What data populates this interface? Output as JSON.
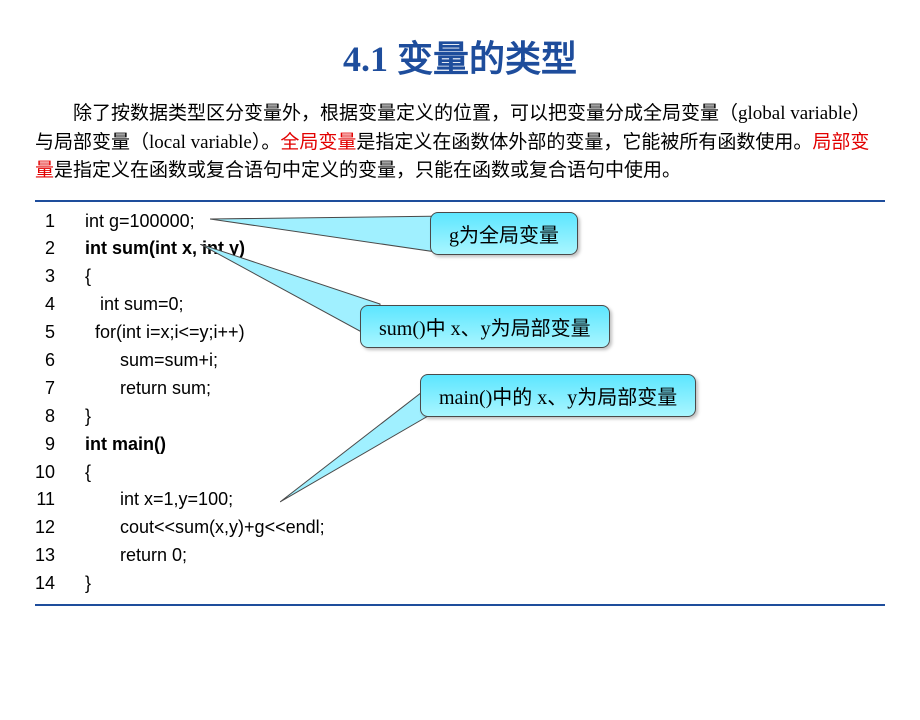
{
  "title": "4.1 变量的类型",
  "paragraph": {
    "part1": "除了按数据类型区分变量外，根据变量定义的位置，可以把变量分成全局变量（global variable）与局部变量（local variable）。",
    "red1": "全局变量",
    "part2": "是指定义在函数体外部的变量，它能被所有函数使用。",
    "red2": "局部变量",
    "part3": "是指定义在函数或复合语句中定义的变量，只能在函数或复合语句中使用。"
  },
  "code": [
    {
      "n": "1",
      "text": "int g=100000;",
      "bold": false
    },
    {
      "n": "2",
      "text": "int sum(int x, int y)",
      "bold": true
    },
    {
      "n": "3",
      "text": "{",
      "bold": false
    },
    {
      "n": "4",
      "text": "   int sum=0;",
      "bold": false
    },
    {
      "n": "5",
      "text": "  for(int i=x;i<=y;i++)",
      "bold": false
    },
    {
      "n": "6",
      "text": "       sum=sum+i;",
      "bold": false
    },
    {
      "n": "7",
      "text": "       return sum;",
      "bold": false
    },
    {
      "n": "8",
      "text": "}",
      "bold": false
    },
    {
      "n": "9",
      "text": "int main()",
      "bold": true
    },
    {
      "n": "10",
      "text": "{",
      "bold": false
    },
    {
      "n": "11",
      "text": "       int x=1,y=100;",
      "bold": false
    },
    {
      "n": "12",
      "text": "       cout<<sum(x,y)+g<<endl;",
      "bold": false
    },
    {
      "n": "13",
      "text": "       return 0;",
      "bold": false
    },
    {
      "n": "14",
      "text": "}",
      "bold": false
    }
  ],
  "callouts": {
    "c1": "g为全局变量",
    "c2": "sum()中 x、y为局部变量",
    "c3": "main()中的 x、y为局部变量"
  }
}
